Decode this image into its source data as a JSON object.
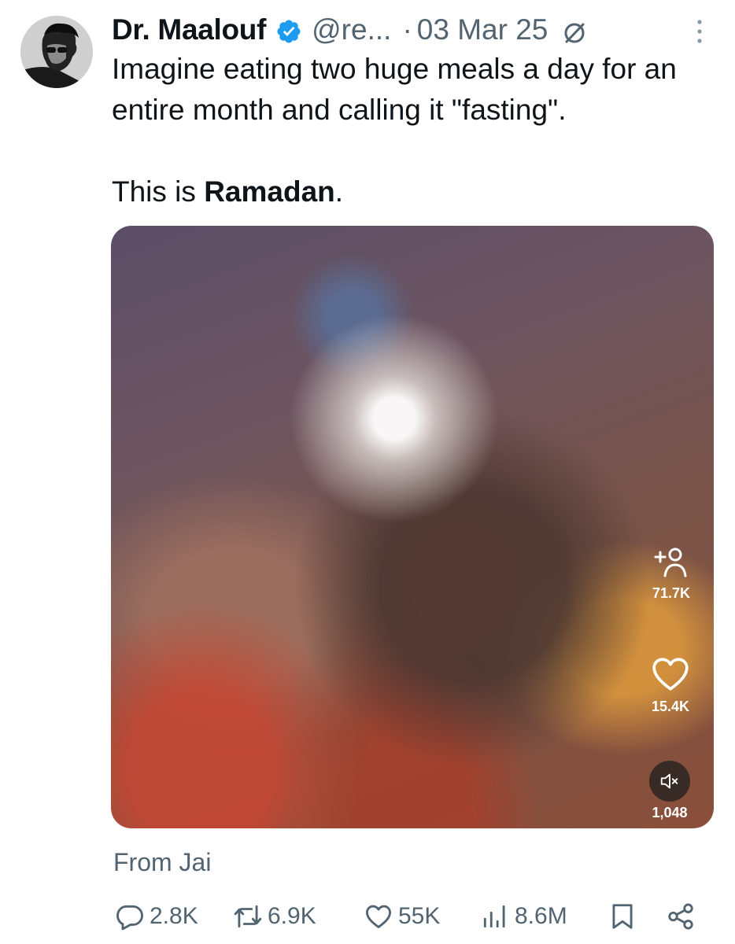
{
  "author": {
    "display_name": "Dr. Maalouf",
    "handle": "@re...",
    "separator": "·",
    "date": "03 Mar 25"
  },
  "post": {
    "line1": "Imagine eating two huge meals a day for an entire month and calling it \"fasting\".",
    "line2_prefix": "This is ",
    "line2_bold": "Ramadan",
    "line2_suffix": "."
  },
  "media": {
    "follow_count": "71.7K",
    "like_count": "15.4K",
    "share_count": "1,048"
  },
  "attribution": "From Jai",
  "actions": {
    "replies": "2.8K",
    "reposts": "6.9K",
    "likes": "55K",
    "views": "8.6M"
  },
  "colors": {
    "text": "#0f1419",
    "muted": "#536471",
    "verified": "#1d9bf0"
  },
  "icons": {
    "verified": "verified-badge-icon",
    "grok": "grok-icon",
    "more": "more-vertical-icon",
    "follow": "add-person-icon",
    "heart": "heart-icon",
    "mute": "mute-icon",
    "reply": "reply-icon",
    "repost": "repost-icon",
    "like": "like-icon",
    "views": "views-icon",
    "bookmark": "bookmark-icon",
    "share": "share-icon"
  }
}
